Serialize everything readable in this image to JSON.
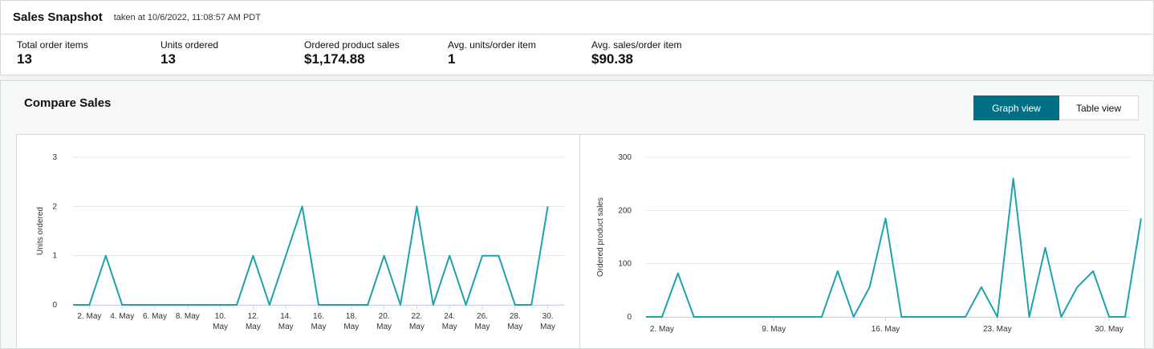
{
  "snapshot": {
    "title": "Sales Snapshot",
    "taken_at": "taken at 10/6/2022, 11:08:57 AM PDT"
  },
  "metrics": [
    {
      "label": "Total order items",
      "value": "13"
    },
    {
      "label": "Units ordered",
      "value": "13"
    },
    {
      "label": "Ordered product sales",
      "value": "$1,174.88"
    },
    {
      "label": "Avg. units/order item",
      "value": "1"
    },
    {
      "label": "Avg. sales/order item",
      "value": "$90.38"
    }
  ],
  "compare": {
    "title": "Compare Sales",
    "graph_view_label": "Graph view",
    "table_view_label": "Table view"
  },
  "colors": {
    "accent": "#007185",
    "line": "#1ca3ac",
    "grid": "#e3e6e6"
  },
  "chart_data": [
    {
      "type": "line",
      "ylabel": "Units ordered",
      "xlabel": "",
      "ylim": [
        0,
        3
      ],
      "yticks": [
        0,
        1,
        2,
        3
      ],
      "x": [
        1,
        2,
        3,
        4,
        5,
        6,
        7,
        8,
        9,
        10,
        11,
        12,
        13,
        14,
        15,
        16,
        17,
        18,
        19,
        20,
        21,
        22,
        23,
        24,
        25,
        26,
        27,
        28,
        29,
        30,
        31
      ],
      "xtick_labels": [
        {
          "day": 2,
          "line1": "2. May",
          "line2": ""
        },
        {
          "day": 4,
          "line1": "4. May",
          "line2": ""
        },
        {
          "day": 6,
          "line1": "6. May",
          "line2": ""
        },
        {
          "day": 8,
          "line1": "8. May",
          "line2": ""
        },
        {
          "day": 10,
          "line1": "10.",
          "line2": "May"
        },
        {
          "day": 12,
          "line1": "12.",
          "line2": "May"
        },
        {
          "day": 14,
          "line1": "14.",
          "line2": "May"
        },
        {
          "day": 16,
          "line1": "16.",
          "line2": "May"
        },
        {
          "day": 18,
          "line1": "18.",
          "line2": "May"
        },
        {
          "day": 20,
          "line1": "20.",
          "line2": "May"
        },
        {
          "day": 22,
          "line1": "22.",
          "line2": "May"
        },
        {
          "day": 24,
          "line1": "24.",
          "line2": "May"
        },
        {
          "day": 26,
          "line1": "26.",
          "line2": "May"
        },
        {
          "day": 28,
          "line1": "28.",
          "line2": "May"
        },
        {
          "day": 30,
          "line1": "30.",
          "line2": "May"
        }
      ],
      "series": [
        {
          "values": [
            0,
            0,
            1,
            0,
            0,
            0,
            0,
            0,
            0,
            0,
            0,
            1,
            0,
            1,
            2,
            0,
            0,
            0,
            0,
            1,
            0,
            2,
            0,
            1,
            0,
            1,
            1,
            0,
            0,
            2
          ]
        }
      ],
      "grid": true
    },
    {
      "type": "line",
      "ylabel": "Ordered product sales",
      "xlabel": "",
      "ylim": [
        0,
        300
      ],
      "yticks": [
        0,
        100,
        200,
        300
      ],
      "x": [
        1,
        2,
        3,
        4,
        5,
        6,
        7,
        8,
        9,
        10,
        11,
        12,
        13,
        14,
        15,
        16,
        17,
        18,
        19,
        20,
        21,
        22,
        23,
        24,
        25,
        26,
        27,
        28,
        29,
        30,
        31
      ],
      "xtick_labels": [
        {
          "day": 2,
          "line1": "2. May",
          "line2": ""
        },
        {
          "day": 9,
          "line1": "9. May",
          "line2": ""
        },
        {
          "day": 16,
          "line1": "16. May",
          "line2": ""
        },
        {
          "day": 23,
          "line1": "23. May",
          "line2": ""
        },
        {
          "day": 30,
          "line1": "30. May",
          "line2": ""
        }
      ],
      "series": [
        {
          "values": [
            0,
            0,
            82,
            0,
            0,
            0,
            0,
            0,
            0,
            0,
            0,
            0,
            86,
            0,
            56,
            185,
            0,
            0,
            0,
            0,
            0,
            56,
            0,
            260,
            0,
            130,
            0,
            56,
            86,
            0,
            0,
            185
          ]
        }
      ],
      "grid": true
    }
  ]
}
